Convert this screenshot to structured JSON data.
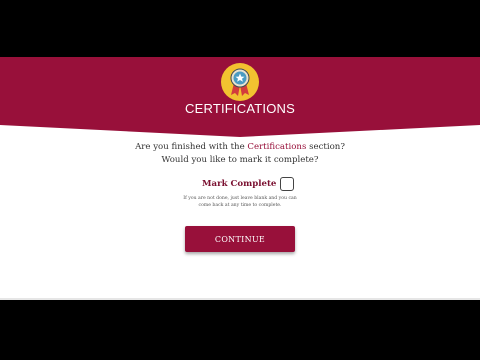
{
  "banner": {
    "title": "CERTIFICATIONS",
    "color": "#98103a",
    "badge_icon": "award-ribbon-icon"
  },
  "question": {
    "line1_before": "Are you finished with the ",
    "line1_highlight": "Certifications",
    "line1_after": " section?",
    "line2": "Would you like to mark it complete?"
  },
  "mark_complete": {
    "label": "Mark Complete",
    "checked": false
  },
  "hint": {
    "line1": "If you are not done, just leave blank and you can",
    "line2": "come back at any time to complete."
  },
  "continue_button": {
    "label": "CONTINUE"
  }
}
